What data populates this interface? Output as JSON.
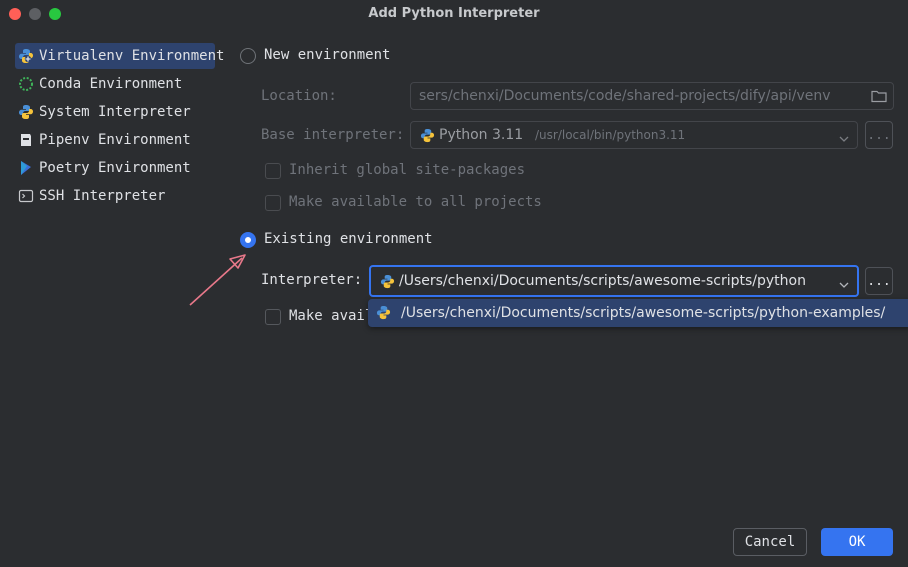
{
  "window": {
    "title": "Add Python Interpreter"
  },
  "sidebar": {
    "items": [
      {
        "label": "Virtualenv Environment",
        "icon": "virtualenv-icon",
        "selected": true
      },
      {
        "label": "Conda Environment",
        "icon": "conda-icon",
        "selected": false
      },
      {
        "label": "System Interpreter",
        "icon": "python-icon",
        "selected": false
      },
      {
        "label": "Pipenv Environment",
        "icon": "pipenv-icon",
        "selected": false
      },
      {
        "label": "Poetry Environment",
        "icon": "poetry-icon",
        "selected": false
      },
      {
        "label": "SSH Interpreter",
        "icon": "terminal-icon",
        "selected": false
      }
    ]
  },
  "new_env": {
    "radio_label": "New environment",
    "location_label": "Location:",
    "location_value": "sers/chenxi/Documents/code/shared-projects/dify/api/venv",
    "base_label": "Base interpreter:",
    "base_version": "Python 3.11",
    "base_path": "/usr/local/bin/python3.11",
    "inherit_label": "Inherit global site-packages",
    "make_available_label": "Make available to all projects",
    "browse_label": "..."
  },
  "existing_env": {
    "radio_label": "Existing environment",
    "interpreter_label": "Interpreter:",
    "interpreter_value": "/Users/chenxi/Documents/scripts/awesome-scripts/python",
    "dropdown_option": "/Users/chenxi/Documents/scripts/awesome-scripts/python-examples/",
    "make_available_label": "Make avail",
    "browse_label": "..."
  },
  "buttons": {
    "cancel": "Cancel",
    "ok": "OK"
  },
  "colors": {
    "accent": "#3574f0",
    "annotation_arrow": "#e8788a",
    "selection": "#2e436e"
  }
}
